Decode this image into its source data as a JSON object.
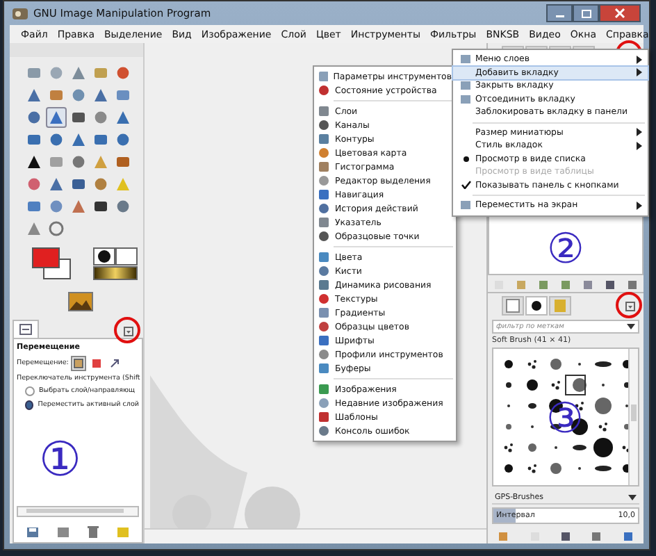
{
  "window": {
    "title": "GNU Image Manipulation Program"
  },
  "menu_bar": [
    "Файл",
    "Правка",
    "Выделение",
    "Вид",
    "Изображение",
    "Слой",
    "Цвет",
    "Инструменты",
    "Фильтры",
    "BNKSB",
    "Видео",
    "Окна",
    "Справка"
  ],
  "toolbox": {
    "tools": [
      {
        "selected": false
      },
      {
        "selected": false
      },
      {
        "selected": false
      },
      {
        "selected": false
      },
      {
        "selected": false
      },
      {
        "selected": false
      },
      {
        "selected": false
      },
      {
        "selected": false
      },
      {
        "selected": false
      },
      {
        "selected": false
      },
      {
        "selected": false
      },
      {
        "selected": true
      },
      {
        "selected": false
      },
      {
        "selected": false
      },
      {
        "selected": false
      },
      {
        "selected": false
      },
      {
        "selected": false
      },
      {
        "selected": false
      },
      {
        "selected": false
      },
      {
        "selected": false
      },
      {
        "selected": false
      },
      {
        "selected": false
      },
      {
        "selected": false
      },
      {
        "selected": false
      },
      {
        "selected": false
      },
      {
        "selected": false
      },
      {
        "selected": false
      },
      {
        "selected": false
      },
      {
        "selected": false
      },
      {
        "selected": false
      },
      {
        "selected": false
      },
      {
        "selected": false
      },
      {
        "selected": false
      },
      {
        "selected": false
      },
      {
        "selected": false
      },
      {
        "selected": false
      }
    ]
  },
  "tool_options": {
    "title": "Перемещение",
    "move_label": "Перемещение:",
    "move_modes": [
      {
        "selected": true
      },
      {
        "selected": false
      },
      {
        "selected": false
      }
    ],
    "toggle_label": "Переключатель инструмента  (Shift",
    "options": [
      {
        "label": "Выбрать слой/направляющ",
        "selected": false
      },
      {
        "label": "Переместить активный слой",
        "selected": true
      }
    ],
    "marker": "①"
  },
  "layers_dock": {
    "marker": "②"
  },
  "add_tab_submenu": {
    "groups": [
      [
        "Параметры инструментов",
        "Состояние устройства"
      ],
      [
        "Слои",
        "Каналы",
        "Контуры",
        "Цветовая карта",
        "Гистограмма",
        "Редактор выделения",
        "Навигация",
        "История действий",
        "Указатель",
        "Образцовые точки"
      ],
      [
        "Цвета",
        "Кисти",
        "Динамика рисования",
        "Текстуры",
        "Градиенты",
        "Образцы цветов",
        "Шрифты",
        "Профили инструментов",
        "Буферы"
      ],
      [
        "Изображения",
        "Недавние изображения",
        "Шаблоны",
        "Консоль ошибок"
      ]
    ]
  },
  "dock_menu": {
    "items": [
      {
        "kind": "item",
        "label": "Меню слоев",
        "icon": true,
        "submenu": true,
        "selected": false,
        "disabled": false
      },
      {
        "kind": "item",
        "label": "Добавить вкладку",
        "icon": false,
        "submenu": true,
        "selected": true,
        "disabled": false
      },
      {
        "kind": "item",
        "label": "Закрыть вкладку",
        "icon": true,
        "submenu": false,
        "selected": false,
        "disabled": false
      },
      {
        "kind": "item",
        "label": "Отсоединить вкладку",
        "icon": true,
        "submenu": false,
        "selected": false,
        "disabled": false
      },
      {
        "kind": "item",
        "label": "Заблокировать вкладку в панели",
        "icon": false,
        "submenu": false,
        "selected": false,
        "disabled": false
      },
      {
        "kind": "separator"
      },
      {
        "kind": "item",
        "label": "Размер миниатюры",
        "icon": false,
        "submenu": true,
        "selected": false,
        "disabled": false
      },
      {
        "kind": "item",
        "label": "Стиль вкладок",
        "icon": false,
        "submenu": true,
        "selected": false,
        "disabled": false
      },
      {
        "kind": "radio",
        "label": "Просмотр в виде списка",
        "checked": true,
        "selected": false,
        "disabled": false
      },
      {
        "kind": "radio",
        "label": "Просмотр в виде таблицы",
        "checked": false,
        "selected": false,
        "disabled": true
      },
      {
        "kind": "check",
        "label": "Показывать панель с кнопками",
        "checked": true,
        "selected": false,
        "disabled": false
      },
      {
        "kind": "separator"
      },
      {
        "kind": "item",
        "label": "Переместить на экран",
        "icon": true,
        "submenu": true,
        "selected": false,
        "disabled": false
      }
    ]
  },
  "brushes_dock": {
    "tabs": [
      {
        "selected": false
      },
      {
        "selected": true
      },
      {
        "selected": false
      }
    ],
    "filter": {
      "placeholder": "фильтр по меткам"
    },
    "brush_name": "Soft Brush (41 × 41)",
    "marker": "③",
    "preset": "GPS-Brushes",
    "spacing": {
      "label": "Интервал",
      "value": "10,0",
      "level": 0.15
    }
  }
}
